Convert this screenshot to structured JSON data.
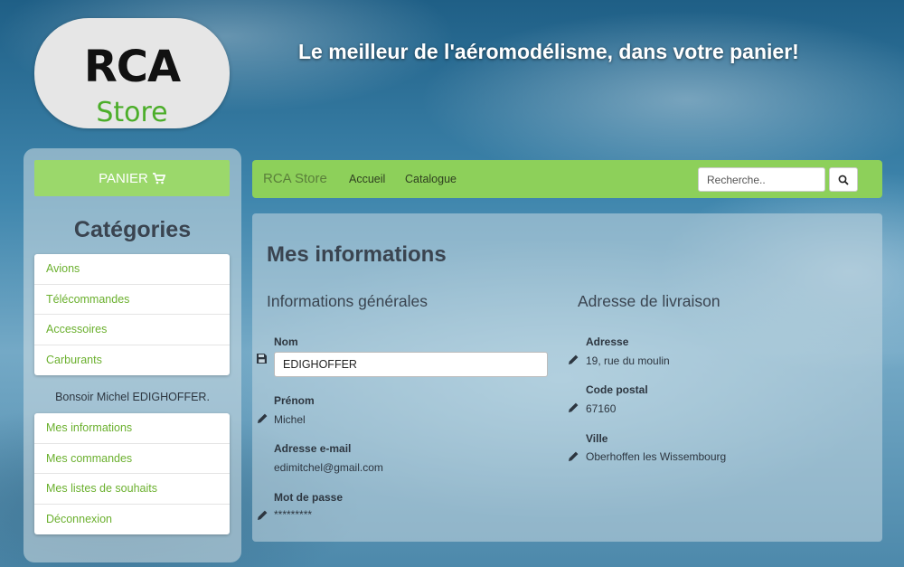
{
  "logo": {
    "line1": "RCA",
    "line2": "Store"
  },
  "tagline": "Le meilleur de l'aéromodélisme, dans votre panier!",
  "sidebar": {
    "cart_label": "PANIER",
    "categories_title": "Catégories",
    "categories": [
      "Avions",
      "Télécommandes",
      "Accessoires",
      "Carburants"
    ],
    "greeting": "Bonsoir Michel EDIGHOFFER.",
    "account_links": [
      "Mes informations",
      "Mes commandes",
      "Mes listes de souhaits",
      "Déconnexion"
    ]
  },
  "navbar": {
    "brand": "RCA Store",
    "links": [
      "Accueil",
      "Catalogue"
    ],
    "search_placeholder": "Recherche.."
  },
  "main": {
    "title": "Mes informations",
    "general": {
      "title": "Informations générales",
      "nom_label": "Nom",
      "nom_value": "EDIGHOFFER",
      "prenom_label": "Prénom",
      "prenom_value": "Michel",
      "email_label": "Adresse e-mail",
      "email_value": "edimitchel@gmail.com",
      "password_label": "Mot de passe",
      "password_value": "*********"
    },
    "delivery": {
      "title": "Adresse de livraison",
      "address_label": "Adresse",
      "address_value": "19, rue du moulin",
      "postal_label": "Code postal",
      "postal_value": "67160",
      "city_label": "Ville",
      "city_value": "Oberhoffen les Wissembourg"
    }
  },
  "colors": {
    "accent_green": "#8dd05a",
    "link_green": "#6bb02e",
    "logo_green": "#4cae2a"
  },
  "icons": [
    "cart-icon",
    "search-icon",
    "save-icon",
    "pencil-icon"
  ]
}
